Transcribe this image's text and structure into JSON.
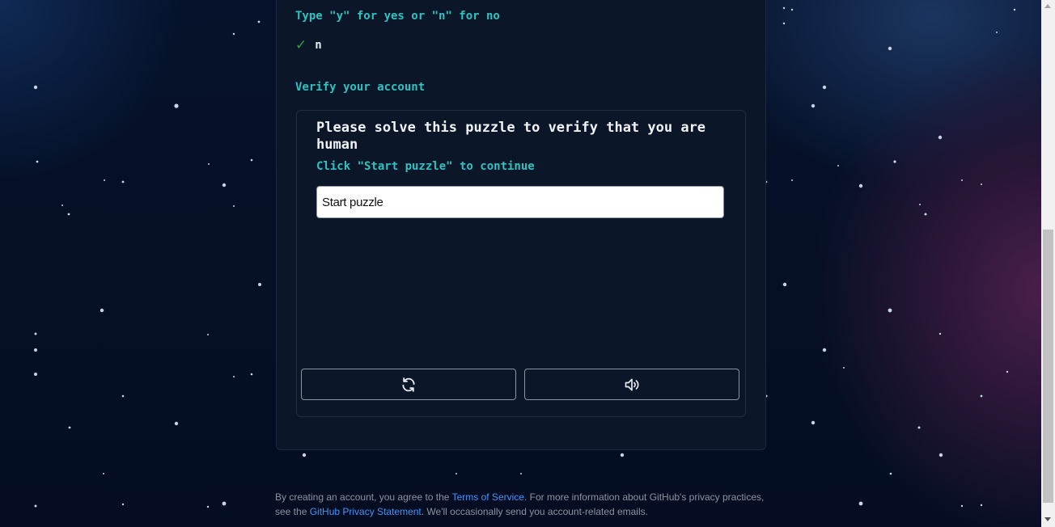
{
  "signup": {
    "prompt": "Type \"y\" for yes or \"n\" for no",
    "answer_check": "✓",
    "answer": "n",
    "verify_label": "Verify your account"
  },
  "puzzle": {
    "title": "Please solve this puzzle to verify that you are human",
    "instruction": "Click \"Start puzzle\" to continue",
    "start_button": "Start puzzle",
    "controls": [
      {
        "name": "refresh",
        "icon": "refresh-icon"
      },
      {
        "name": "audio",
        "icon": "speaker-icon"
      }
    ]
  },
  "footer": {
    "text_1": "By creating an account, you agree to the ",
    "terms_link": "Terms of Service",
    "text_2": ". For more information about GitHub's privacy practices, see the ",
    "privacy_link": "GitHub Privacy Statement",
    "text_3": ". We'll occasionally send you account-related emails."
  },
  "colors": {
    "accent_teal": "#2dc3c3",
    "link_blue": "#4493f8",
    "check_green": "#2ea043",
    "background": "#06122b"
  }
}
